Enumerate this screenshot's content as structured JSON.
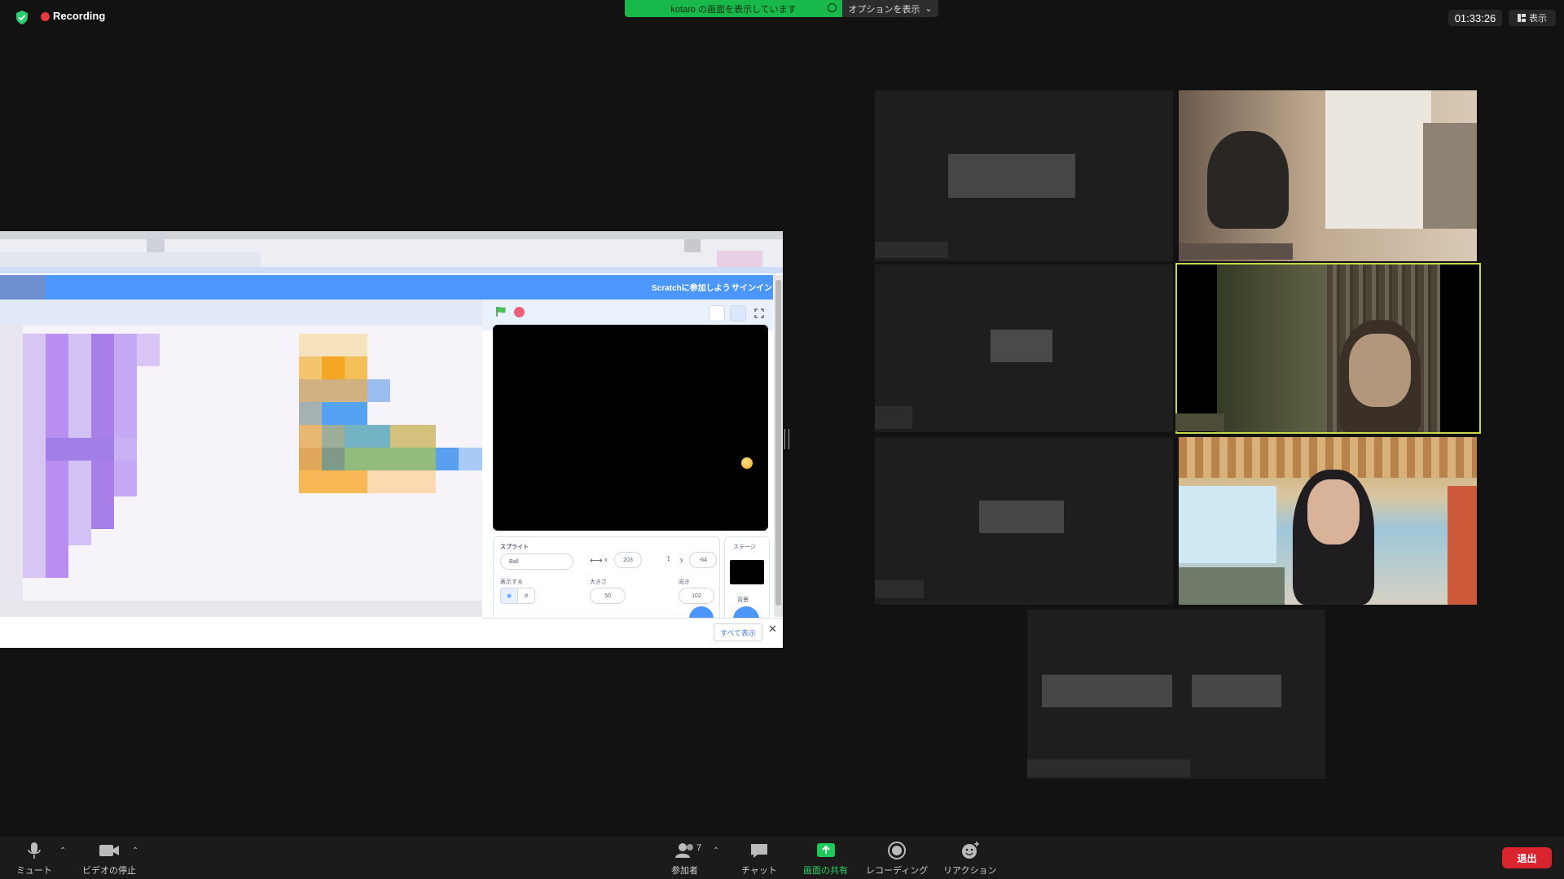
{
  "recording": {
    "label": "Recording"
  },
  "share_banner": {
    "text": "kotaro の画面を表示しています",
    "options_label": "オプションを表示"
  },
  "clock": "01:33:26",
  "view_label": "表示",
  "scratch": {
    "join_label": "Scratchに参加しよう",
    "signin_label": "サインイン",
    "sprite_label": "スプライト",
    "sprite_name": "Ball",
    "x_label": "x",
    "x_value": "203",
    "y_label": "y",
    "y_value": "-64",
    "show_label": "表示する",
    "size_label": "大きさ",
    "size_value": "50",
    "direction_label": "向き",
    "direction_value": "102",
    "stage_label": "ステージ",
    "backdrop_label": "背景",
    "show_all_label": "すべて表示",
    "close_symbol": "✕"
  },
  "toolbar": {
    "mute": "ミュート",
    "video": "ビデオの停止",
    "participants": "参加者",
    "participant_count": "7",
    "chat": "チャット",
    "share": "画面の共有",
    "record": "レコーディング",
    "reaction": "リアクション",
    "leave": "退出"
  },
  "colors": {
    "accent_green": "#19b84a",
    "leave_red": "#d9242e",
    "active_speaker": "#c6d84a",
    "scratch_blue": "#4c97ff"
  }
}
